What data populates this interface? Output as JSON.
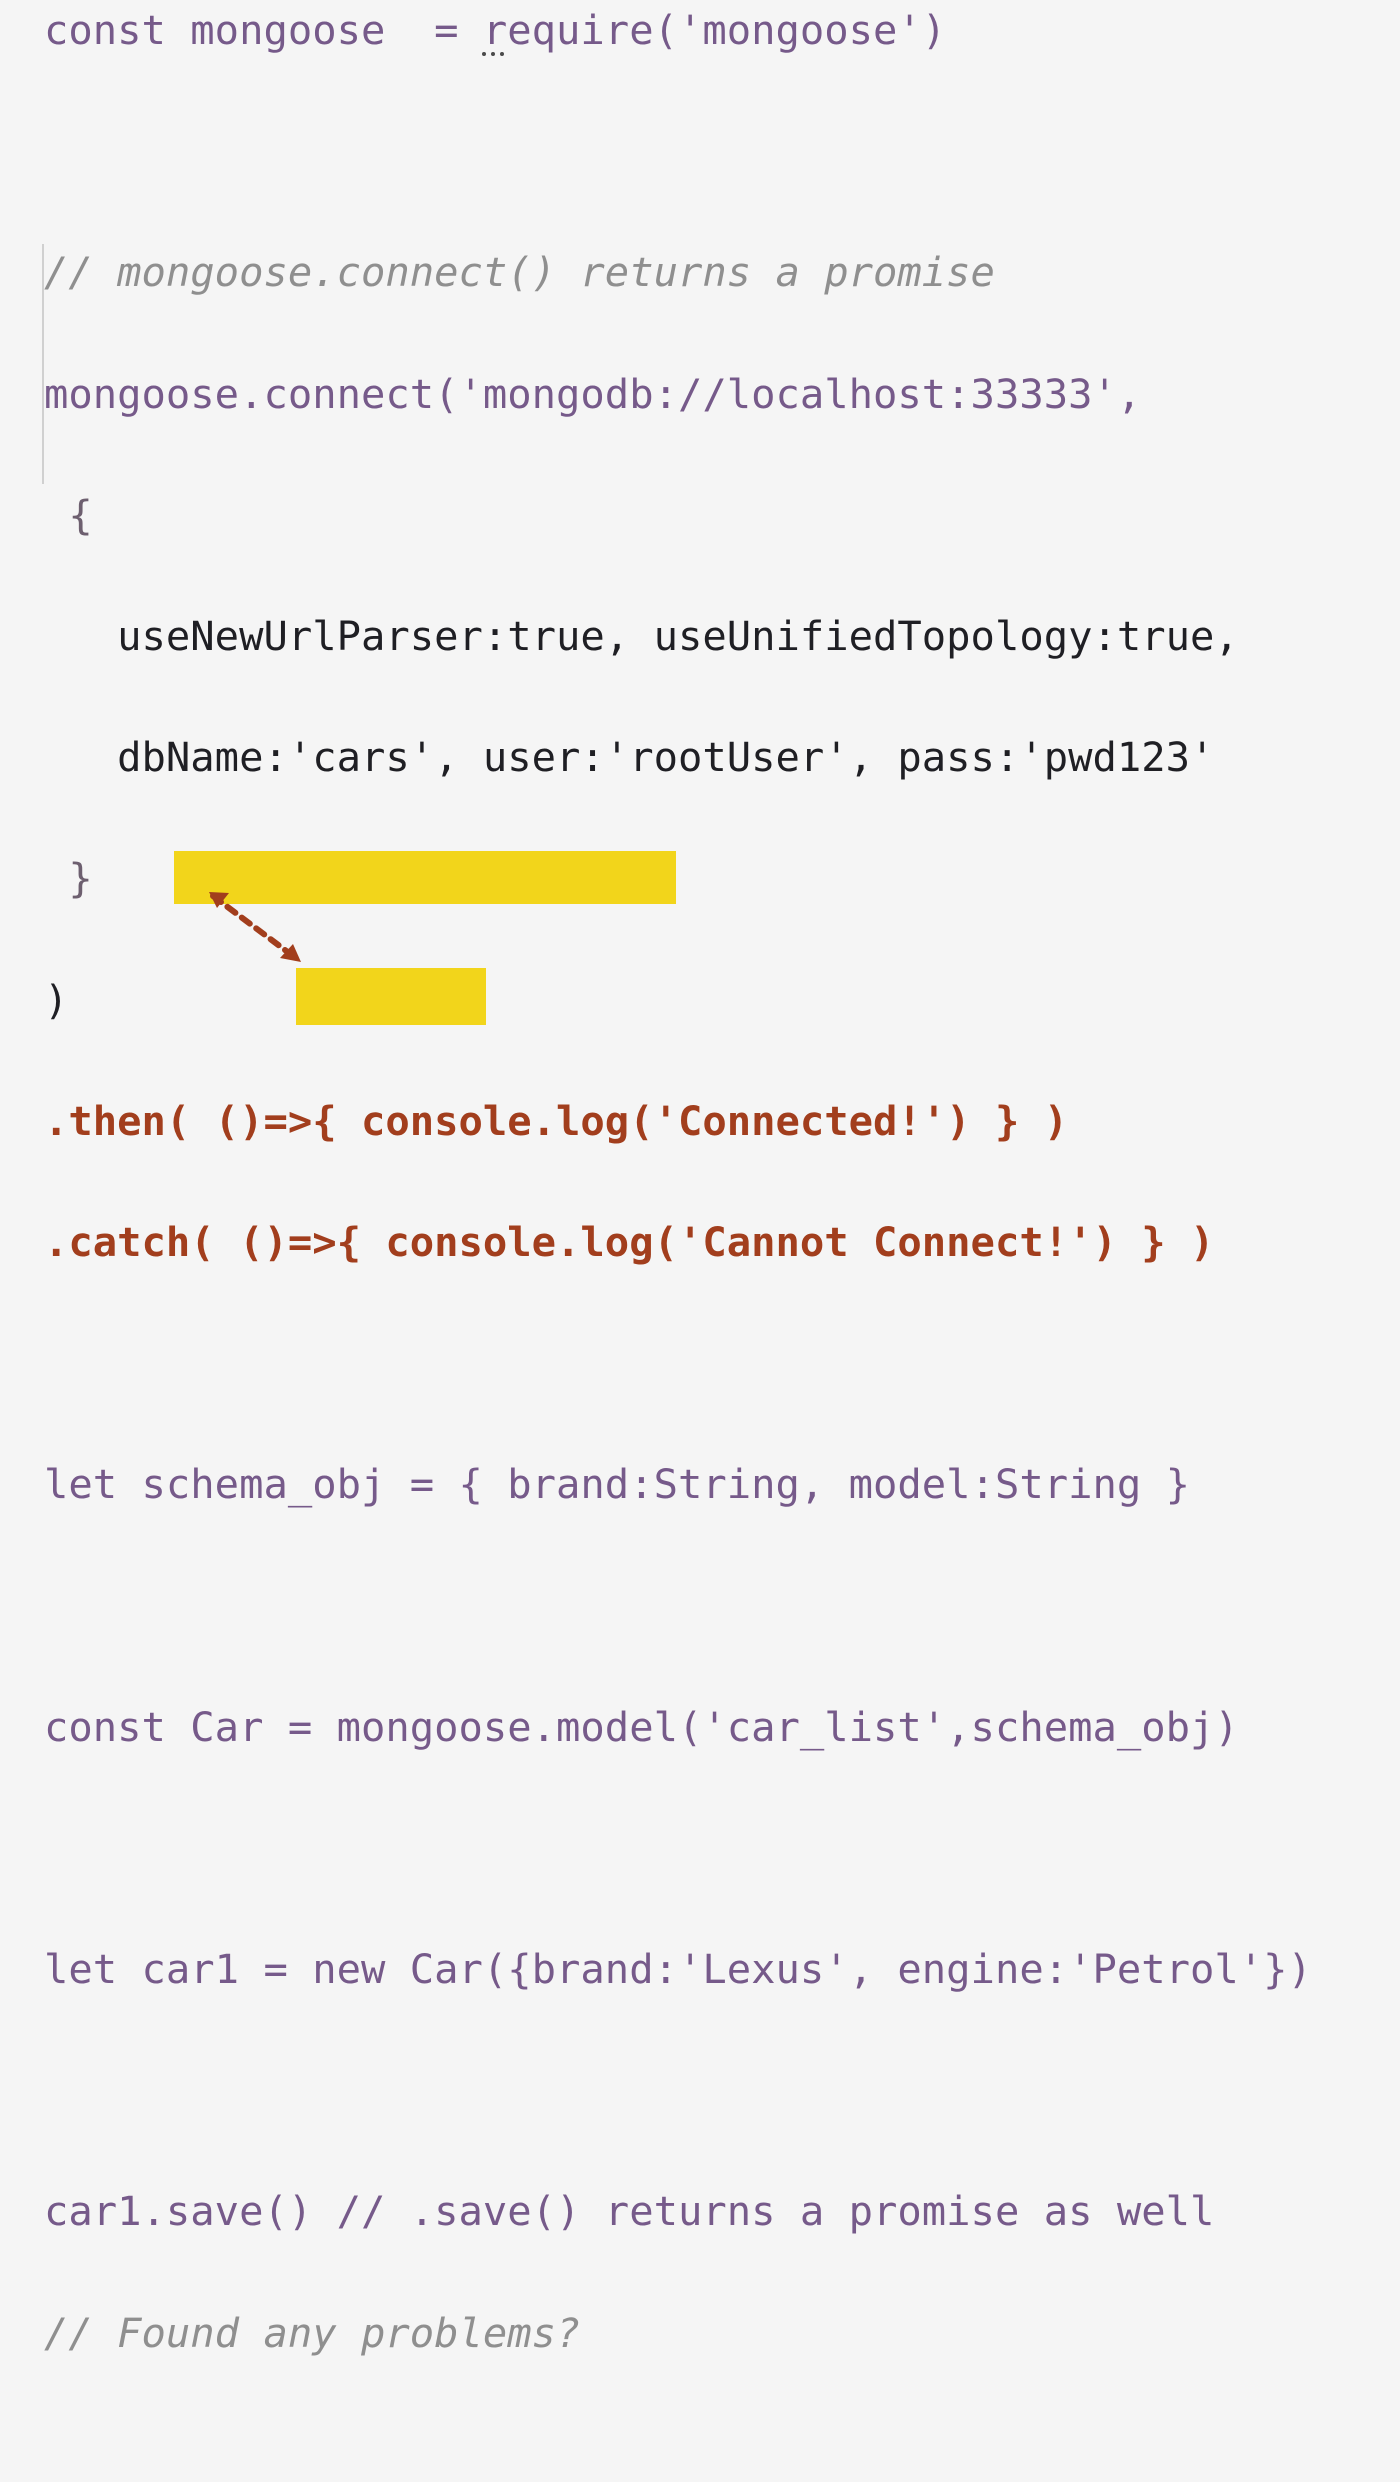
{
  "editor": {
    "lines": [
      "const mongoose  = require('mongoose')",
      "",
      "// mongoose.connect() returns a promise",
      "mongoose.connect('mongodb://localhost:33333',",
      " {",
      "   useNewUrlParser:true, useUnifiedTopology:true,",
      "   dbName:'cars', user:'rootUser', pass:'pwd123'",
      " }",
      ")",
      ".then( ()=>{ console.log('Connected!') } )",
      ".catch( ()=>{ console.log('Cannot Connect!') } )",
      "",
      "let schema_obj = { brand:String, model:String }",
      "",
      "const Car = mongoose.model('car_list',schema_obj)",
      "",
      "let car1 = new Car({brand:'Lexus', engine:'Petrol'})",
      "",
      "car1.save() // .save() returns a promise as well",
      "// Found any problems?"
    ]
  },
  "colors": {
    "background": "#f5f5f5",
    "keyword": "#765a8a",
    "function": "#a23e1d",
    "string": "#1f7f2a",
    "comment": "#8f8f8f",
    "highlight": "#f2d51b",
    "arrow": "#a23e1d"
  },
  "icons": {
    "arrow": "dashed-arrow-icon",
    "ellipsis": "ellipsis-icon"
  }
}
